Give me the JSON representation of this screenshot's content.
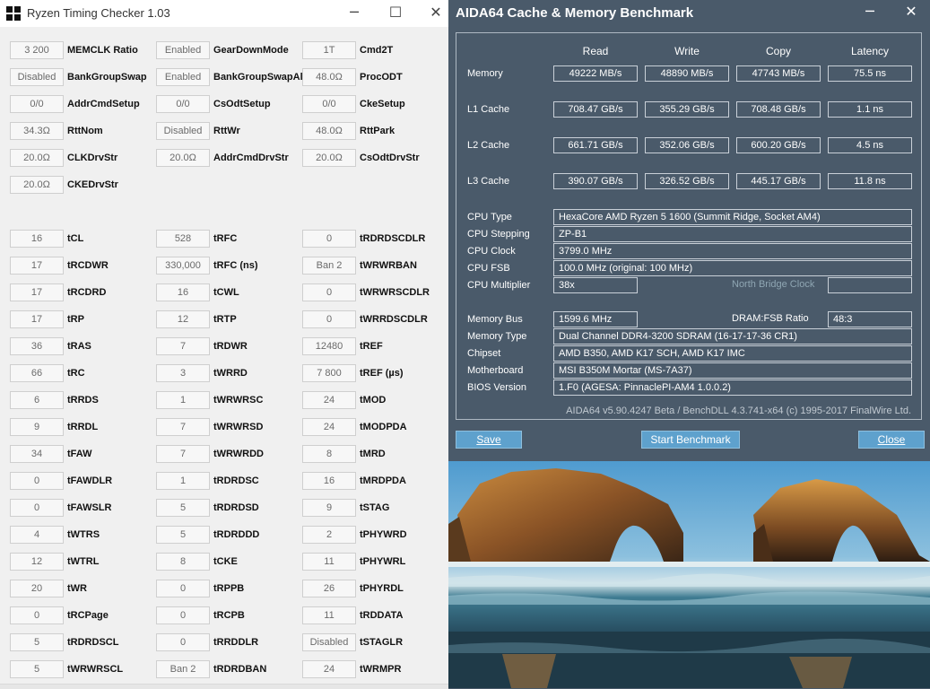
{
  "rtc": {
    "title": "Ryzen Timing Checker 1.03",
    "buttons": {
      "minimize": "─",
      "maximize": "☐",
      "close": "✕"
    },
    "rows": [
      [
        {
          "v": "3 200",
          "l": "MEMCLK Ratio"
        },
        {
          "v": "Enabled",
          "l": "GearDownMode"
        },
        {
          "v": "1T",
          "l": "Cmd2T"
        }
      ],
      [
        {
          "v": "Disabled",
          "l": "BankGroupSwap"
        },
        {
          "v": "Enabled",
          "l": "BankGroupSwapAlt"
        },
        {
          "v": "48.0Ω",
          "l": "ProcODT"
        }
      ],
      [
        {
          "v": "0/0",
          "l": "AddrCmdSetup"
        },
        {
          "v": "0/0",
          "l": "CsOdtSetup"
        },
        {
          "v": "0/0",
          "l": "CkeSetup"
        }
      ],
      [
        {
          "v": "34.3Ω",
          "l": "RttNom"
        },
        {
          "v": "Disabled",
          "l": "RttWr"
        },
        {
          "v": "48.0Ω",
          "l": "RttPark"
        }
      ],
      [
        {
          "v": "20.0Ω",
          "l": "CLKDrvStr"
        },
        {
          "v": "20.0Ω",
          "l": "AddrCmdDrvStr"
        },
        {
          "v": "20.0Ω",
          "l": "CsOdtDrvStr"
        }
      ],
      [
        {
          "v": "20.0Ω",
          "l": "CKEDrvStr"
        },
        null,
        null
      ],
      [
        null,
        null,
        null
      ],
      [
        {
          "v": "16",
          "l": "tCL"
        },
        {
          "v": "528",
          "l": "tRFC"
        },
        {
          "v": "0",
          "l": "tRDRDSCDLR"
        }
      ],
      [
        {
          "v": "17",
          "l": "tRCDWR"
        },
        {
          "v": "330,000",
          "l": "tRFC (ns)"
        },
        {
          "v": "Ban 2",
          "l": "tWRWRBAN"
        }
      ],
      [
        {
          "v": "17",
          "l": "tRCDRD"
        },
        {
          "v": "16",
          "l": "tCWL"
        },
        {
          "v": "0",
          "l": "tWRWRSCDLR"
        }
      ],
      [
        {
          "v": "17",
          "l": "tRP"
        },
        {
          "v": "12",
          "l": "tRTP"
        },
        {
          "v": "0",
          "l": "tWRRDSCDLR"
        }
      ],
      [
        {
          "v": "36",
          "l": "tRAS"
        },
        {
          "v": "7",
          "l": "tRDWR"
        },
        {
          "v": "12480",
          "l": "tREF"
        }
      ],
      [
        {
          "v": "66",
          "l": "tRC"
        },
        {
          "v": "3",
          "l": "tWRRD"
        },
        {
          "v": "7 800",
          "l": "tREF (µs)"
        }
      ],
      [
        {
          "v": "6",
          "l": "tRRDS"
        },
        {
          "v": "1",
          "l": "tWRWRSC"
        },
        {
          "v": "24",
          "l": "tMOD"
        }
      ],
      [
        {
          "v": "9",
          "l": "tRRDL"
        },
        {
          "v": "7",
          "l": "tWRWRSD"
        },
        {
          "v": "24",
          "l": "tMODPDA"
        }
      ],
      [
        {
          "v": "34",
          "l": "tFAW"
        },
        {
          "v": "7",
          "l": "tWRWRDD"
        },
        {
          "v": "8",
          "l": "tMRD"
        }
      ],
      [
        {
          "v": "0",
          "l": "tFAWDLR"
        },
        {
          "v": "1",
          "l": "tRDRDSC"
        },
        {
          "v": "16",
          "l": "tMRDPDA"
        }
      ],
      [
        {
          "v": "0",
          "l": "tFAWSLR"
        },
        {
          "v": "5",
          "l": "tRDRDSD"
        },
        {
          "v": "9",
          "l": "tSTAG"
        }
      ],
      [
        {
          "v": "4",
          "l": "tWTRS"
        },
        {
          "v": "5",
          "l": "tRDRDDD"
        },
        {
          "v": "2",
          "l": "tPHYWRD"
        }
      ],
      [
        {
          "v": "12",
          "l": "tWTRL"
        },
        {
          "v": "8",
          "l": "tCKE"
        },
        {
          "v": "11",
          "l": "tPHYWRL"
        }
      ],
      [
        {
          "v": "20",
          "l": "tWR"
        },
        {
          "v": "0",
          "l": "tRPPB"
        },
        {
          "v": "26",
          "l": "tPHYRDL"
        }
      ],
      [
        {
          "v": "0",
          "l": "tRCPage"
        },
        {
          "v": "0",
          "l": "tRCPB"
        },
        {
          "v": "11",
          "l": "tRDDATA"
        }
      ],
      [
        {
          "v": "5",
          "l": "tRDRDSCL"
        },
        {
          "v": "0",
          "l": "tRRDDLR"
        },
        {
          "v": "Disabled",
          "l": "tSTAGLR"
        }
      ],
      [
        {
          "v": "5",
          "l": "tWRWRSCL"
        },
        {
          "v": "Ban 2",
          "l": "tRDRDBAN"
        },
        {
          "v": "24",
          "l": "tWRMPR"
        }
      ]
    ]
  },
  "aida": {
    "title": "AIDA64 Cache & Memory Benchmark",
    "buttons": {
      "minimize": "─",
      "close": "✕"
    },
    "headers": [
      "Read",
      "Write",
      "Copy",
      "Latency"
    ],
    "bench": [
      {
        "label": "Memory",
        "read": "49222 MB/s",
        "write": "48890 MB/s",
        "copy": "47743 MB/s",
        "latency": "75.5 ns"
      },
      {
        "label": "L1 Cache",
        "read": "708.47 GB/s",
        "write": "355.29 GB/s",
        "copy": "708.48 GB/s",
        "latency": "1.1 ns"
      },
      {
        "label": "L2 Cache",
        "read": "661.71 GB/s",
        "write": "352.06 GB/s",
        "copy": "600.20 GB/s",
        "latency": "4.5 ns"
      },
      {
        "label": "L3 Cache",
        "read": "390.07 GB/s",
        "write": "326.52 GB/s",
        "copy": "445.17 GB/s",
        "latency": "11.8 ns"
      }
    ],
    "cpu": {
      "type_label": "CPU Type",
      "type": "HexaCore AMD Ryzen 5 1600  (Summit Ridge, Socket AM4)",
      "stepping_label": "CPU Stepping",
      "stepping": "ZP-B1",
      "clock_label": "CPU Clock",
      "clock": "3799.0 MHz",
      "fsb_label": "CPU FSB",
      "fsb": "100.0 MHz  (original: 100 MHz)",
      "mult_label": "CPU Multiplier",
      "mult": "38x",
      "nb_label": "North Bridge Clock",
      "nb": ""
    },
    "mem": {
      "bus_label": "Memory Bus",
      "bus": "1599.6 MHz",
      "ratio_label": "DRAM:FSB Ratio",
      "ratio": "48:3",
      "type_label": "Memory Type",
      "type": "Dual Channel DDR4-3200 SDRAM  (16-17-17-36 CR1)",
      "chipset_label": "Chipset",
      "chipset": "AMD B350, AMD K17 SCH, AMD K17 IMC",
      "mb_label": "Motherboard",
      "mb": "MSI B350M Mortar (MS-7A37)",
      "bios_label": "BIOS Version",
      "bios": "1.F0  (AGESA: PinnaclePI-AM4 1.0.0.2)"
    },
    "footer": "AIDA64 v5.90.4247 Beta / BenchDLL 4.3.741-x64  (c) 1995-2017 FinalWire Ltd.",
    "save_label": "Save",
    "start_label": "Start Benchmark",
    "close_label": "Close"
  }
}
